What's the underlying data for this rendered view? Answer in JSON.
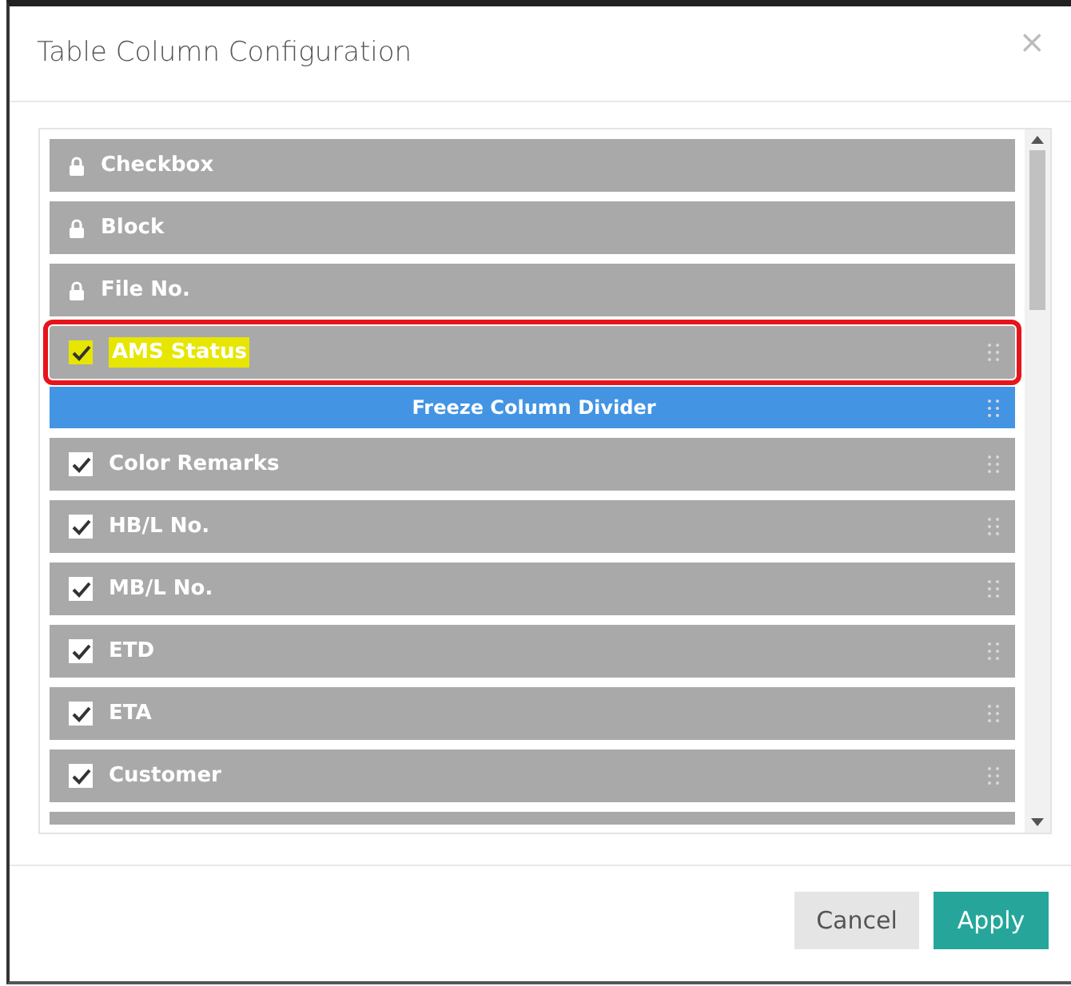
{
  "dialog": {
    "title": "Table Column Configuration",
    "close": "×"
  },
  "columns": [
    {
      "kind": "locked",
      "label": "Checkbox"
    },
    {
      "kind": "locked",
      "label": "Block"
    },
    {
      "kind": "locked",
      "label": "File No."
    },
    {
      "kind": "column",
      "label": "AMS Status",
      "checked": true,
      "highlighted": true
    },
    {
      "kind": "divider",
      "label": "Freeze Column Divider"
    },
    {
      "kind": "column",
      "label": "Color Remarks",
      "checked": true,
      "highlighted": false
    },
    {
      "kind": "column",
      "label": "HB/L No.",
      "checked": true,
      "highlighted": false
    },
    {
      "kind": "column",
      "label": "MB/L No.",
      "checked": true,
      "highlighted": false
    },
    {
      "kind": "column",
      "label": "ETD",
      "checked": true,
      "highlighted": false
    },
    {
      "kind": "column",
      "label": "ETA",
      "checked": true,
      "highlighted": false
    },
    {
      "kind": "column",
      "label": "Customer",
      "checked": true,
      "highlighted": false
    }
  ],
  "buttons": [
    {
      "label": "Cancel",
      "kind": "secondary"
    },
    {
      "label": "Apply",
      "kind": "primary"
    }
  ]
}
